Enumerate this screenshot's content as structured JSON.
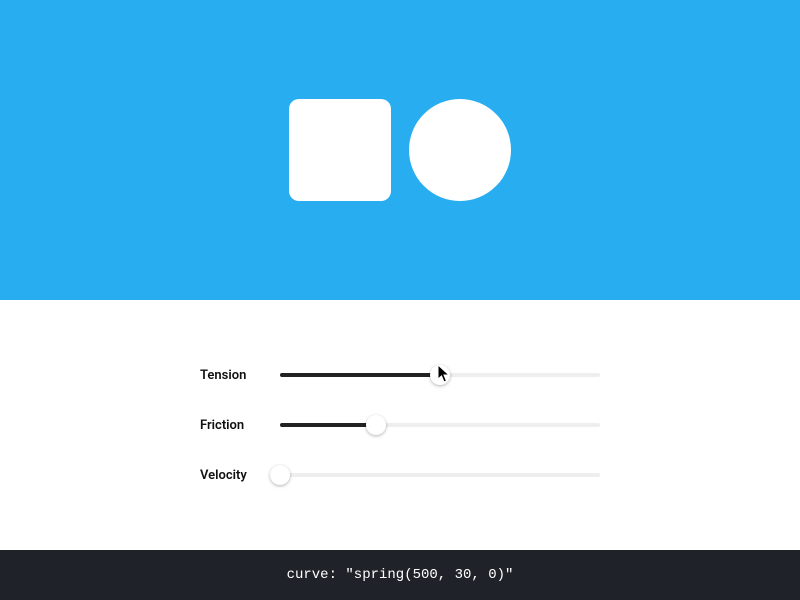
{
  "preview": {
    "background_color": "#28aef0",
    "shapes": [
      "square",
      "circle"
    ]
  },
  "sliders": {
    "tension": {
      "label": "Tension",
      "value": 500,
      "min": 0,
      "max": 1000,
      "percent": 50
    },
    "friction": {
      "label": "Friction",
      "value": 30,
      "min": 0,
      "max": 100,
      "percent": 30
    },
    "velocity": {
      "label": "Velocity",
      "value": 0,
      "min": 0,
      "max": 100,
      "percent": 0
    }
  },
  "code": {
    "text": "curve: \"spring(500, 30, 0)\""
  }
}
